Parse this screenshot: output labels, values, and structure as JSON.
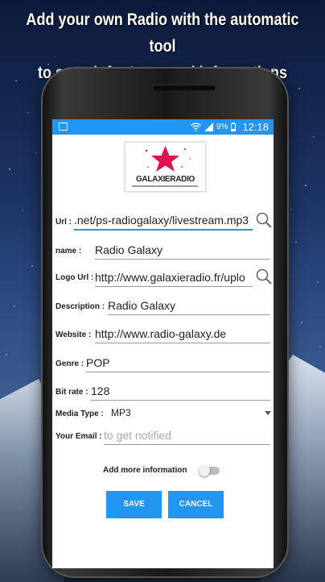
{
  "headline": {
    "line1": "Add your own Radio with the automatic tool",
    "line2": "to search for Logo and informations"
  },
  "status_bar": {
    "battery": "9%",
    "time": "12:18",
    "icons": [
      "screenshot-icon",
      "wifi-icon",
      "signal-icon",
      "battery-icon"
    ]
  },
  "logo": {
    "text": "GALAXIERADIO"
  },
  "form": {
    "url": {
      "label": "Url :",
      "value": ".net/ps-radiogalaxy/livestream.mp3"
    },
    "name": {
      "label": "name :",
      "value": "Radio Galaxy"
    },
    "logo_url": {
      "label": "Logo Url :",
      "value": "http://www.galaxieradio.fr/uplo"
    },
    "description": {
      "label": "Description :",
      "value": "Radio Galaxy"
    },
    "website": {
      "label": "Website :",
      "value": "http://www.radio-galaxy.de"
    },
    "genre": {
      "label": "Genre :",
      "value": "POP"
    },
    "bitrate": {
      "label": "Bit rate :",
      "value": "128"
    },
    "media_type": {
      "label": "Media Type :",
      "value": "MP3"
    },
    "email": {
      "label": "Your Email :",
      "placeholder": "to get notified"
    }
  },
  "more_info": {
    "label": "Add more information",
    "enabled": false
  },
  "buttons": {
    "save": "SAVE",
    "cancel": "CANCEL"
  },
  "colors": {
    "accent": "#2196f3",
    "logo_star": "#e0134f"
  }
}
